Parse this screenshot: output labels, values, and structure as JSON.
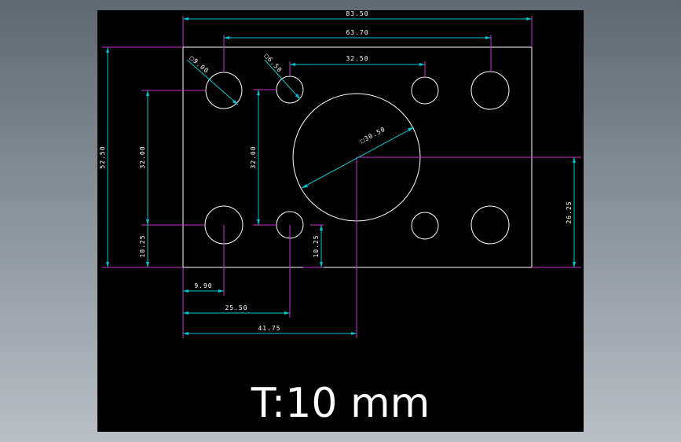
{
  "drawing": {
    "dimensions": {
      "overall_width": "83.50",
      "hole_span_width": "63.70",
      "small_hole_span": "32.50",
      "overall_height": "52.50",
      "left_vertical_pitch": "32.00",
      "inner_vertical_pitch": "32.00",
      "left_bottom_offset": "10.25",
      "inner_bottom_offset": "10.25",
      "center_height": "26.25",
      "left_hole_offset": "9.90",
      "inner_hole_offset": "25.50",
      "center_offset": "41.75",
      "large_hole_diameter": "□9.00",
      "small_hole_diameter": "□6.50",
      "center_hole_diameter": "□30.50"
    },
    "thickness": "T:10 mm",
    "colors": {
      "background": "#000000",
      "geometry": "#ffffff",
      "extension_lines": "#c832c8",
      "dimension_lines": "#00c8d2"
    }
  }
}
